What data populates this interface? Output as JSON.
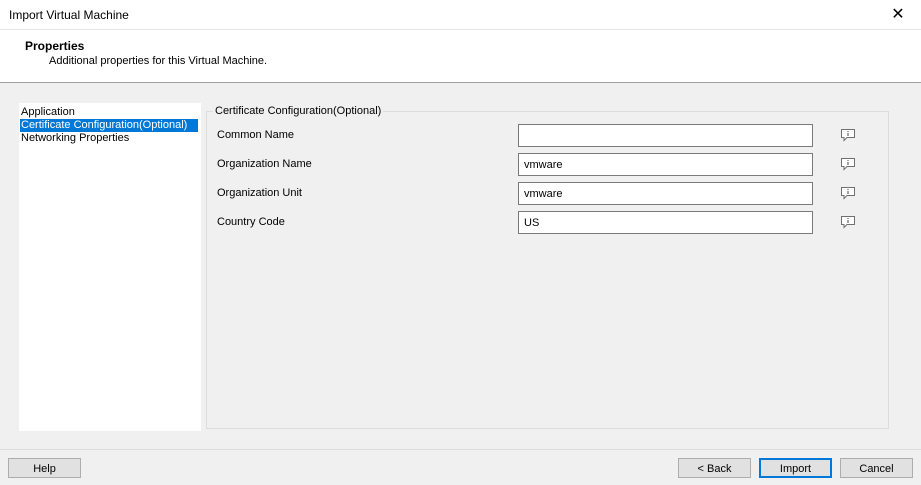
{
  "window": {
    "title": "Import Virtual Machine",
    "close_glyph": "✕"
  },
  "header": {
    "title": "Properties",
    "subtitle": "Additional properties for this Virtual Machine."
  },
  "nav": {
    "items": [
      {
        "label": "Application"
      },
      {
        "label": "Certificate Configuration(Optional)",
        "selected": true
      },
      {
        "label": "Networking Properties"
      }
    ]
  },
  "group": {
    "caption": "Certificate Configuration(Optional)",
    "fields": [
      {
        "label": "Common Name",
        "value": ""
      },
      {
        "label": "Organization Name",
        "value": "vmware"
      },
      {
        "label": "Organization Unit",
        "value": "vmware"
      },
      {
        "label": "Country Code",
        "value": "US"
      }
    ],
    "info_icon": "info-comment-icon"
  },
  "footer": {
    "help": "Help",
    "back": "< Back",
    "import": "Import",
    "cancel": "Cancel"
  },
  "colors": {
    "selection": "#0078d7",
    "dialog_bg": "#f0f0f0"
  }
}
